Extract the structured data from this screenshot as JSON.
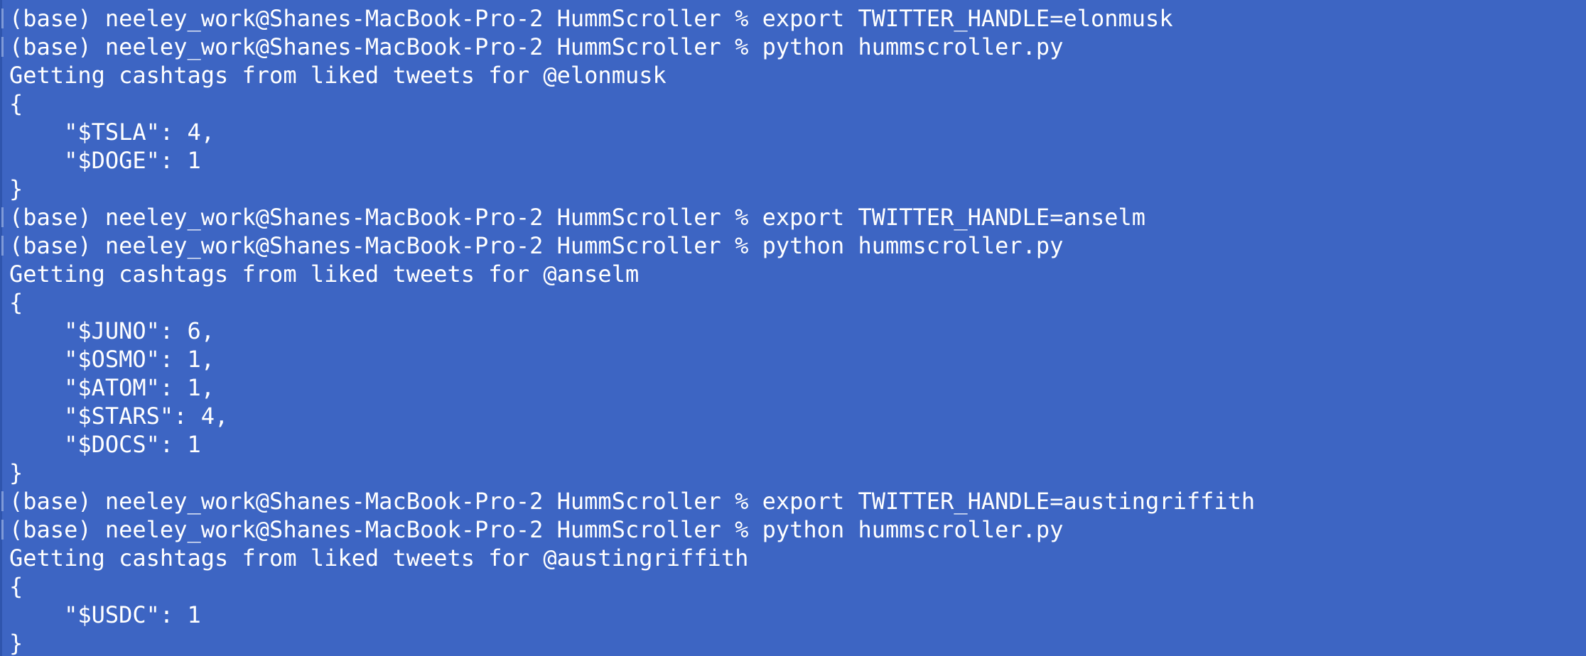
{
  "terminal": {
    "lines": [
      {
        "type": "prompt",
        "text": "(base) neeley_work@Shanes-MacBook-Pro-2 HummScroller % export TWITTER_HANDLE=elonmusk"
      },
      {
        "type": "prompt",
        "text": "(base) neeley_work@Shanes-MacBook-Pro-2 HummScroller % python hummscroller.py"
      },
      {
        "type": "output",
        "text": "Getting cashtags from liked tweets for @elonmusk"
      },
      {
        "type": "output",
        "text": "{"
      },
      {
        "type": "output",
        "text": "    \"$TSLA\": 4,"
      },
      {
        "type": "output",
        "text": "    \"$DOGE\": 1"
      },
      {
        "type": "output",
        "text": "}"
      },
      {
        "type": "prompt",
        "text": "(base) neeley_work@Shanes-MacBook-Pro-2 HummScroller % export TWITTER_HANDLE=anselm"
      },
      {
        "type": "prompt",
        "text": "(base) neeley_work@Shanes-MacBook-Pro-2 HummScroller % python hummscroller.py"
      },
      {
        "type": "output",
        "text": "Getting cashtags from liked tweets for @anselm"
      },
      {
        "type": "output",
        "text": "{"
      },
      {
        "type": "output",
        "text": "    \"$JUNO\": 6,"
      },
      {
        "type": "output",
        "text": "    \"$OSMO\": 1,"
      },
      {
        "type": "output",
        "text": "    \"$ATOM\": 1,"
      },
      {
        "type": "output",
        "text": "    \"$STARS\": 4,"
      },
      {
        "type": "output",
        "text": "    \"$DOCS\": 1"
      },
      {
        "type": "output",
        "text": "}"
      },
      {
        "type": "prompt",
        "text": "(base) neeley_work@Shanes-MacBook-Pro-2 HummScroller % export TWITTER_HANDLE=austingriffith"
      },
      {
        "type": "prompt",
        "text": "(base) neeley_work@Shanes-MacBook-Pro-2 HummScroller % python hummscroller.py"
      },
      {
        "type": "output",
        "text": "Getting cashtags from liked tweets for @austingriffith"
      },
      {
        "type": "output",
        "text": "{"
      },
      {
        "type": "output",
        "text": "    \"$USDC\": 1"
      },
      {
        "type": "output",
        "text": "}"
      }
    ]
  }
}
